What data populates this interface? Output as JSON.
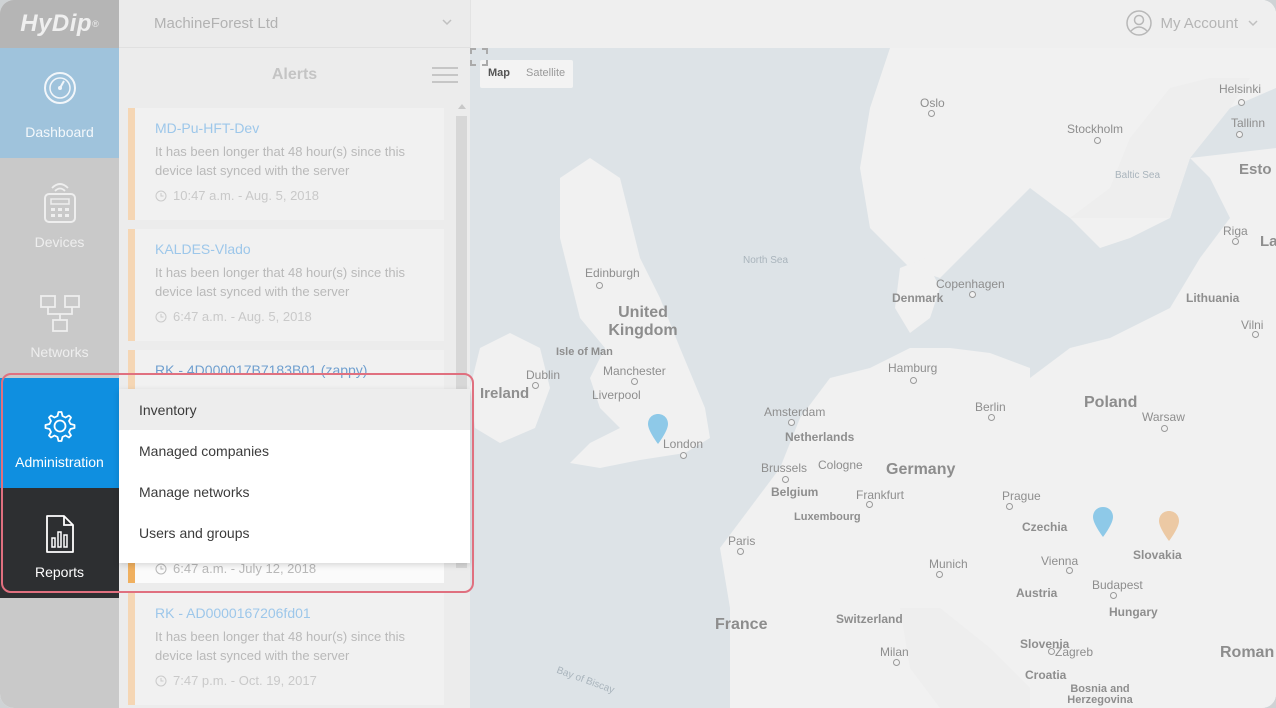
{
  "app": {
    "logo_text": "HyDip",
    "logo_mark": "®"
  },
  "nav": {
    "items": [
      {
        "label": "Dashboard"
      },
      {
        "label": "Devices"
      },
      {
        "label": "Networks"
      },
      {
        "label": "Administration"
      },
      {
        "label": "Reports"
      }
    ]
  },
  "header": {
    "company": "MachineForest Ltd",
    "account": "My Account"
  },
  "alerts": {
    "title": "Alerts",
    "cards": [
      {
        "title": "MD-Pu-HFT-Dev",
        "message": "It has been longer that 48 hour(s) since this device last synced with the server",
        "time": "10:47 a.m. - Aug. 5, 2018"
      },
      {
        "title": "KALDES-Vlado",
        "message": "It has been longer that 48 hour(s) since this device last synced with the server",
        "time": "6:47 a.m. - Aug. 5, 2018"
      },
      {
        "title": "RK - 4D000017B7183B01 (zappy)",
        "message": "",
        "time": ""
      },
      {
        "title": "",
        "message": "",
        "time": "6:47 a.m. - July 12, 2018"
      },
      {
        "title": "RK - AD0000167206fd01",
        "message": "It has been longer that 48 hour(s) since this device last synced with the server",
        "time": "7:47 p.m. - Oct. 19, 2017"
      }
    ]
  },
  "admin_menu": {
    "items": [
      "Inventory",
      "Managed companies",
      "Manage networks",
      "Users and groups"
    ]
  },
  "map": {
    "toggle": [
      "Map",
      "Satellite"
    ],
    "labels": {
      "oslo": "Oslo",
      "stockholm": "Stockholm",
      "helsinki": "Helsinki",
      "tallinn": "Tallinn",
      "esto": "Esto",
      "baltic": "Baltic Sea",
      "riga": "Riga",
      "la": "La",
      "northsea": "North Sea",
      "edinburgh": "Edinburgh",
      "denmark": "Denmark",
      "copenhagen": "Copenhagen",
      "lithuania": "Lithuania",
      "vilni": "Vilni",
      "uk": "United Kingdom",
      "isleofman": "Isle of Man",
      "dublin": "Dublin",
      "manchester": "Manchester",
      "ireland": "Ireland",
      "liverpool": "Liverpool",
      "hamburg": "Hamburg",
      "amsterdam": "Amsterdam",
      "berlin": "Berlin",
      "poland": "Poland",
      "warsaw": "Warsaw",
      "netherlands": "Netherlands",
      "london": "London",
      "brussels": "Brussels",
      "cologne": "Cologne",
      "germany": "Germany",
      "belgium": "Belgium",
      "frankfurt": "Frankfurt",
      "prague": "Prague",
      "luxembourg": "Luxembourg",
      "czechia": "Czechia",
      "paris": "Paris",
      "slovakia": "Slovakia",
      "munich": "Munich",
      "vienna": "Vienna",
      "budapest": "Budapest",
      "austria": "Austria",
      "france": "France",
      "switzerland": "Switzerland",
      "hungary": "Hungary",
      "slovenia": "Slovenia",
      "zagreb": "Zagreb",
      "milan": "Milan",
      "croatia": "Croatia",
      "roman": "Roman",
      "bayofbiscay": "Bay of Biscay",
      "bosnia": "Bosnia and Herzegovina"
    },
    "colors": {
      "water": "#dde3e7",
      "land": "#f1f1f1",
      "pin_blue": "#8ec9e8",
      "pin_orange": "#ecc9a4"
    }
  }
}
